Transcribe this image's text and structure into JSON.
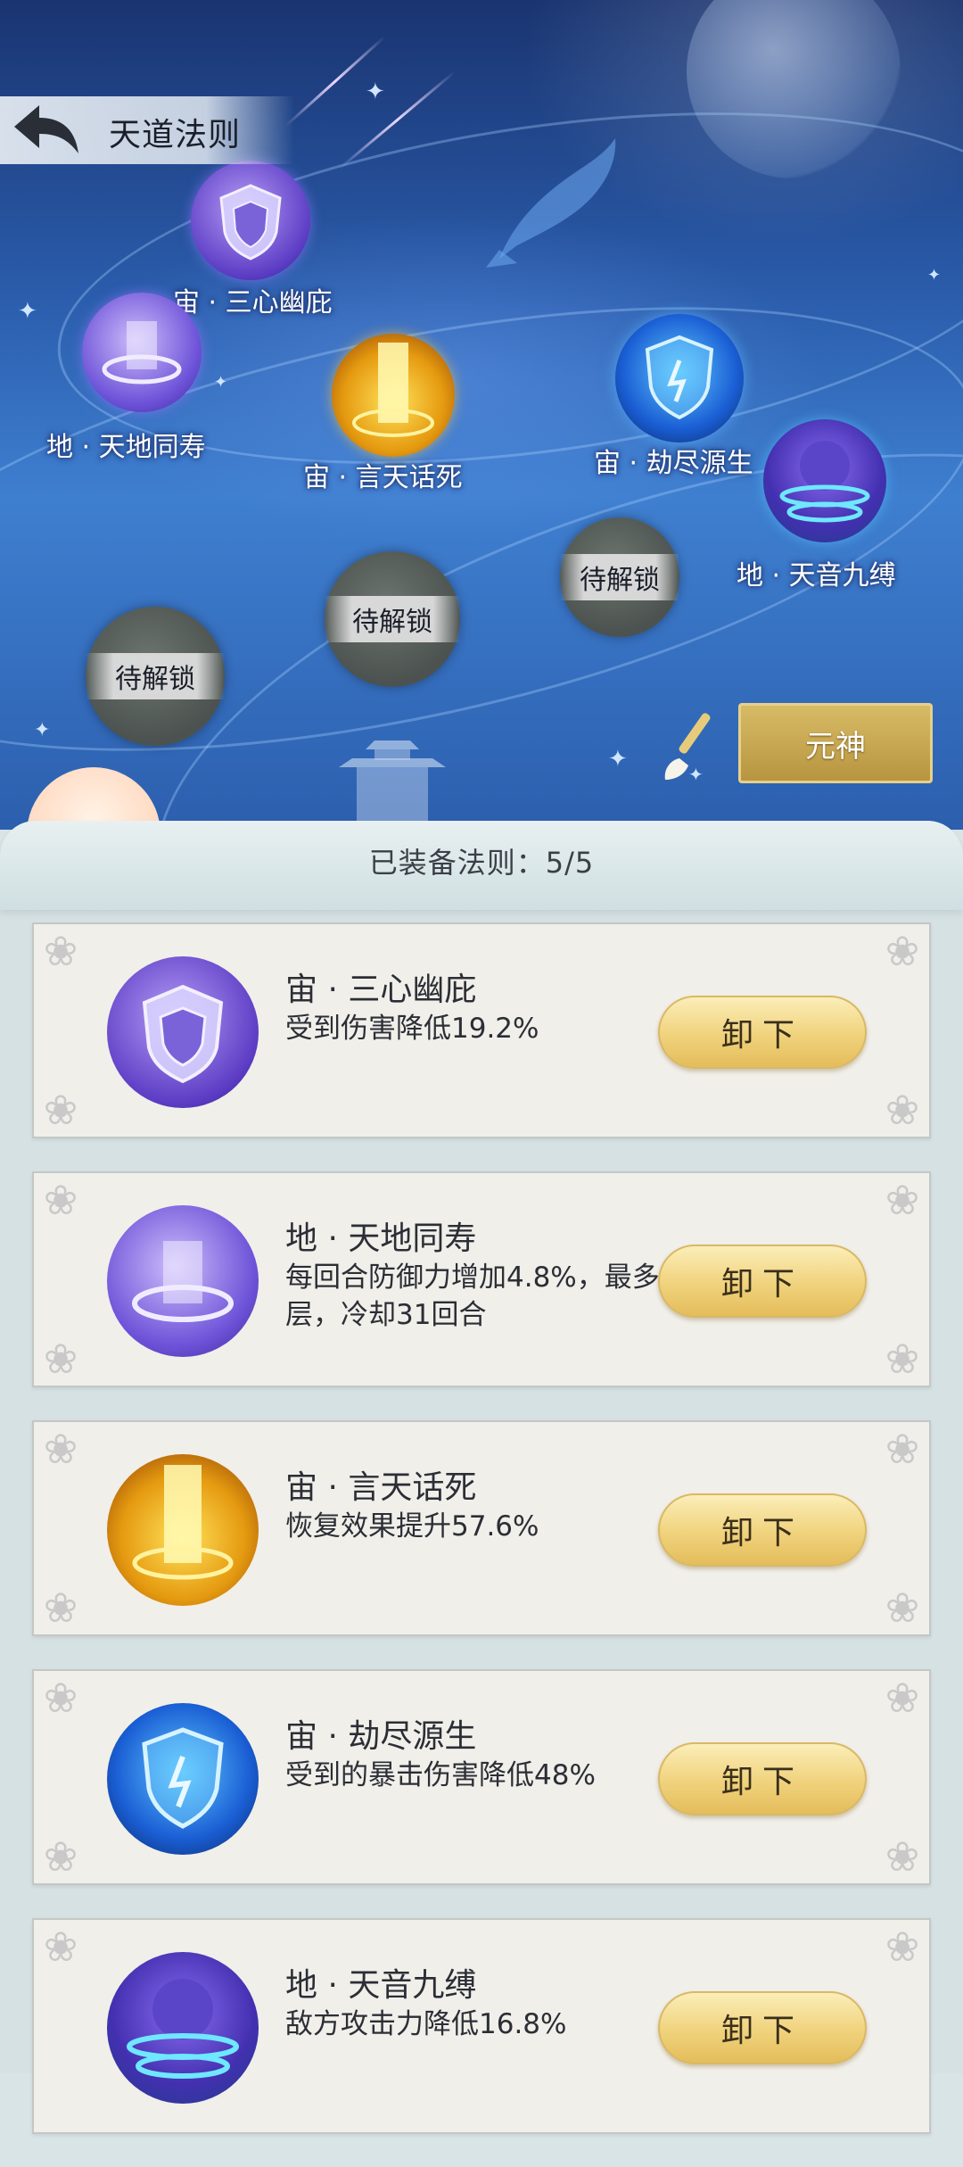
{
  "header": {
    "title": "天道法则"
  },
  "map": {
    "nodes": [
      {
        "label": "宙 · 三心幽庇",
        "icon": "shield-crest-icon"
      },
      {
        "label": "地 · 天地同寿",
        "icon": "purple-vortex-icon"
      },
      {
        "label": "宙 · 言天话死",
        "icon": "golden-light-icon"
      },
      {
        "label": "宙 · 劫尽源生",
        "icon": "blue-shield-icon"
      },
      {
        "label": "地 · 天音九缚",
        "icon": "blue-spirit-icon"
      }
    ],
    "locked": [
      "待解锁",
      "待解锁",
      "待解锁"
    ],
    "yuanshen_label": "元神"
  },
  "panel": {
    "equipped_label": "已装备法则：5/5"
  },
  "cards": [
    {
      "name": "宙 · 三心幽庇",
      "desc": "受到伤害降低19.2%",
      "button": "卸下",
      "icon": "shield-crest-icon"
    },
    {
      "name": "地 · 天地同寿",
      "desc": "每回合防御力增加4.8%，最多8层，冷却31回合",
      "button": "卸下",
      "icon": "purple-vortex-icon"
    },
    {
      "name": "宙 · 言天话死",
      "desc": "恢复效果提升57.6%",
      "button": "卸下",
      "icon": "golden-light-icon"
    },
    {
      "name": "宙 · 劫尽源生",
      "desc": "受到的暴击伤害降低48%",
      "button": "卸下",
      "icon": "blue-shield-icon"
    },
    {
      "name": "地 · 天音九缚",
      "desc": "敌方攻击力降低16.8%",
      "button": "卸下",
      "icon": "blue-spirit-icon"
    }
  ],
  "colors": {
    "accent_gold": "#c9a650",
    "panel_bg": "#d5e1e3",
    "card_bg": "#f1efea"
  }
}
